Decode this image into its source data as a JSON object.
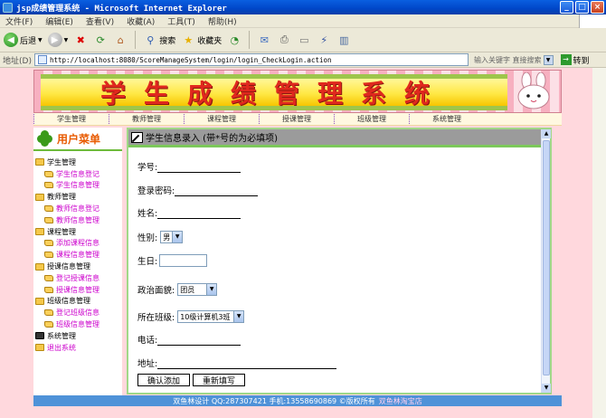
{
  "window": {
    "title": "jsp成绩管理系统 - Microsoft Internet Explorer",
    "controls": [
      "_",
      "□",
      "×"
    ]
  },
  "menubar": [
    "文件(F)",
    "编辑(E)",
    "查看(V)",
    "收藏(A)",
    "工具(T)",
    "帮助(H)"
  ],
  "toolbar": {
    "back": "后退",
    "search": "搜索",
    "favorites": "收藏夹"
  },
  "addressbar": {
    "label": "地址(D)",
    "url": "http://localhost:8080/ScoreManageSystem/login/login_CheckLogin.action",
    "keyword_hint": "输入关键字 直接搜索",
    "go": "转到"
  },
  "banner": {
    "title": "学生成绩管理系统"
  },
  "nav": [
    "学生管理",
    "教师管理",
    "课程管理",
    "授课管理",
    "班级管理",
    "系统管理"
  ],
  "sidebar": {
    "title": "用户菜单",
    "groups": [
      {
        "label": "学生管理",
        "items": [
          "学生信息登记",
          "学生信息管理"
        ]
      },
      {
        "label": "教师管理",
        "items": [
          "教师信息登记",
          "教师信息管理"
        ]
      },
      {
        "label": "课程管理",
        "items": [
          "添加课程信息",
          "课程信息管理"
        ]
      },
      {
        "label": "授课信息管理",
        "items": [
          "登记授课信息",
          "授课信息管理"
        ]
      },
      {
        "label": "班级信息管理",
        "items": [
          "登记班级信息",
          "班级信息管理"
        ]
      },
      {
        "label": "系统管理",
        "items": []
      },
      {
        "label": "退出系统",
        "items": []
      }
    ]
  },
  "form": {
    "header": "学生信息录入 (带*号的为必填项)",
    "student_id_label": "学号:",
    "password_label": "登录密码:",
    "name_label": "姓名:",
    "gender_label": "性别:",
    "gender_value": "男",
    "birthday_label": "生日:",
    "politics_label": "政治面貌:",
    "politics_value": "团员",
    "class_label": "所在班级:",
    "class_value": "10级计算机3班",
    "phone_label": "电话:",
    "address_label": "地址:",
    "submit": "确认添加",
    "reset": "重新填写"
  },
  "footer": {
    "text": "双鱼林设计  QQ:287307421 手机:13558690869 ©版权所有",
    "link": "双鱼林淘宝店"
  },
  "colors": {
    "title_bar": "#0046c8",
    "page_bg": "#ffd8dd",
    "accent_green": "#7cc85a",
    "footer_bg": "#4f92d8",
    "menu_title": "#e85a00",
    "link_magenta": "#cc00cc"
  }
}
